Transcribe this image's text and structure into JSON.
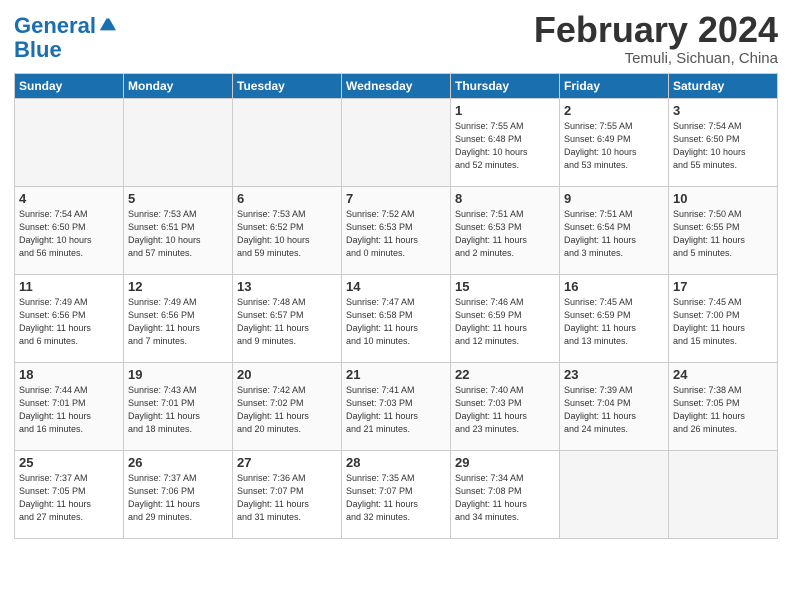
{
  "header": {
    "logo_line1": "General",
    "logo_line2": "Blue",
    "month": "February 2024",
    "location": "Temuli, Sichuan, China"
  },
  "days_of_week": [
    "Sunday",
    "Monday",
    "Tuesday",
    "Wednesday",
    "Thursday",
    "Friday",
    "Saturday"
  ],
  "weeks": [
    [
      {
        "num": "",
        "info": "",
        "empty": true
      },
      {
        "num": "",
        "info": "",
        "empty": true
      },
      {
        "num": "",
        "info": "",
        "empty": true
      },
      {
        "num": "",
        "info": "",
        "empty": true
      },
      {
        "num": "1",
        "info": "Sunrise: 7:55 AM\nSunset: 6:48 PM\nDaylight: 10 hours\nand 52 minutes.",
        "empty": false
      },
      {
        "num": "2",
        "info": "Sunrise: 7:55 AM\nSunset: 6:49 PM\nDaylight: 10 hours\nand 53 minutes.",
        "empty": false
      },
      {
        "num": "3",
        "info": "Sunrise: 7:54 AM\nSunset: 6:50 PM\nDaylight: 10 hours\nand 55 minutes.",
        "empty": false
      }
    ],
    [
      {
        "num": "4",
        "info": "Sunrise: 7:54 AM\nSunset: 6:50 PM\nDaylight: 10 hours\nand 56 minutes.",
        "empty": false
      },
      {
        "num": "5",
        "info": "Sunrise: 7:53 AM\nSunset: 6:51 PM\nDaylight: 10 hours\nand 57 minutes.",
        "empty": false
      },
      {
        "num": "6",
        "info": "Sunrise: 7:53 AM\nSunset: 6:52 PM\nDaylight: 10 hours\nand 59 minutes.",
        "empty": false
      },
      {
        "num": "7",
        "info": "Sunrise: 7:52 AM\nSunset: 6:53 PM\nDaylight: 11 hours\nand 0 minutes.",
        "empty": false
      },
      {
        "num": "8",
        "info": "Sunrise: 7:51 AM\nSunset: 6:53 PM\nDaylight: 11 hours\nand 2 minutes.",
        "empty": false
      },
      {
        "num": "9",
        "info": "Sunrise: 7:51 AM\nSunset: 6:54 PM\nDaylight: 11 hours\nand 3 minutes.",
        "empty": false
      },
      {
        "num": "10",
        "info": "Sunrise: 7:50 AM\nSunset: 6:55 PM\nDaylight: 11 hours\nand 5 minutes.",
        "empty": false
      }
    ],
    [
      {
        "num": "11",
        "info": "Sunrise: 7:49 AM\nSunset: 6:56 PM\nDaylight: 11 hours\nand 6 minutes.",
        "empty": false
      },
      {
        "num": "12",
        "info": "Sunrise: 7:49 AM\nSunset: 6:56 PM\nDaylight: 11 hours\nand 7 minutes.",
        "empty": false
      },
      {
        "num": "13",
        "info": "Sunrise: 7:48 AM\nSunset: 6:57 PM\nDaylight: 11 hours\nand 9 minutes.",
        "empty": false
      },
      {
        "num": "14",
        "info": "Sunrise: 7:47 AM\nSunset: 6:58 PM\nDaylight: 11 hours\nand 10 minutes.",
        "empty": false
      },
      {
        "num": "15",
        "info": "Sunrise: 7:46 AM\nSunset: 6:59 PM\nDaylight: 11 hours\nand 12 minutes.",
        "empty": false
      },
      {
        "num": "16",
        "info": "Sunrise: 7:45 AM\nSunset: 6:59 PM\nDaylight: 11 hours\nand 13 minutes.",
        "empty": false
      },
      {
        "num": "17",
        "info": "Sunrise: 7:45 AM\nSunset: 7:00 PM\nDaylight: 11 hours\nand 15 minutes.",
        "empty": false
      }
    ],
    [
      {
        "num": "18",
        "info": "Sunrise: 7:44 AM\nSunset: 7:01 PM\nDaylight: 11 hours\nand 16 minutes.",
        "empty": false
      },
      {
        "num": "19",
        "info": "Sunrise: 7:43 AM\nSunset: 7:01 PM\nDaylight: 11 hours\nand 18 minutes.",
        "empty": false
      },
      {
        "num": "20",
        "info": "Sunrise: 7:42 AM\nSunset: 7:02 PM\nDaylight: 11 hours\nand 20 minutes.",
        "empty": false
      },
      {
        "num": "21",
        "info": "Sunrise: 7:41 AM\nSunset: 7:03 PM\nDaylight: 11 hours\nand 21 minutes.",
        "empty": false
      },
      {
        "num": "22",
        "info": "Sunrise: 7:40 AM\nSunset: 7:03 PM\nDaylight: 11 hours\nand 23 minutes.",
        "empty": false
      },
      {
        "num": "23",
        "info": "Sunrise: 7:39 AM\nSunset: 7:04 PM\nDaylight: 11 hours\nand 24 minutes.",
        "empty": false
      },
      {
        "num": "24",
        "info": "Sunrise: 7:38 AM\nSunset: 7:05 PM\nDaylight: 11 hours\nand 26 minutes.",
        "empty": false
      }
    ],
    [
      {
        "num": "25",
        "info": "Sunrise: 7:37 AM\nSunset: 7:05 PM\nDaylight: 11 hours\nand 27 minutes.",
        "empty": false
      },
      {
        "num": "26",
        "info": "Sunrise: 7:37 AM\nSunset: 7:06 PM\nDaylight: 11 hours\nand 29 minutes.",
        "empty": false
      },
      {
        "num": "27",
        "info": "Sunrise: 7:36 AM\nSunset: 7:07 PM\nDaylight: 11 hours\nand 31 minutes.",
        "empty": false
      },
      {
        "num": "28",
        "info": "Sunrise: 7:35 AM\nSunset: 7:07 PM\nDaylight: 11 hours\nand 32 minutes.",
        "empty": false
      },
      {
        "num": "29",
        "info": "Sunrise: 7:34 AM\nSunset: 7:08 PM\nDaylight: 11 hours\nand 34 minutes.",
        "empty": false
      },
      {
        "num": "",
        "info": "",
        "empty": true
      },
      {
        "num": "",
        "info": "",
        "empty": true
      }
    ]
  ]
}
